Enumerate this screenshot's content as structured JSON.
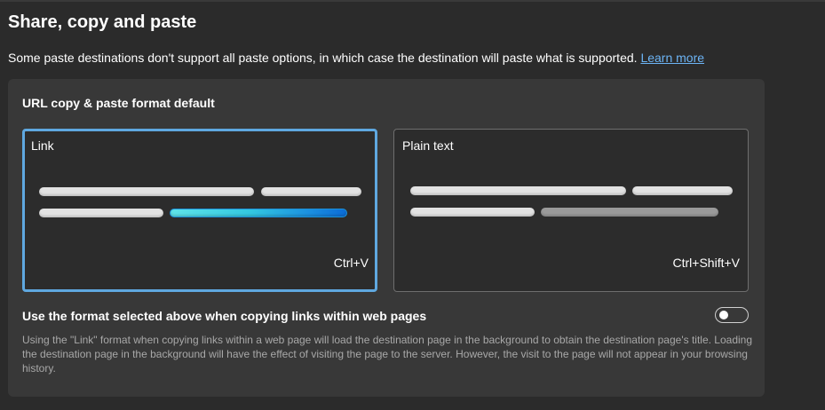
{
  "page": {
    "title": "Share, copy and paste",
    "description": "Some paste destinations don't support all paste options, in which case the destination will paste what is supported.",
    "learn_more": "Learn more"
  },
  "url_format": {
    "heading": "URL copy & paste format default",
    "options": [
      {
        "label": "Link",
        "shortcut": "Ctrl+V",
        "selected": true
      },
      {
        "label": "Plain text",
        "shortcut": "Ctrl+Shift+V",
        "selected": false
      }
    ]
  },
  "within_pages": {
    "label": "Use the format selected above when copying links within web pages",
    "enabled": false,
    "help": "Using the \"Link\" format when copying links within a web page will load the destination page in the background to obtain the destination page's title. Loading the destination page in the background will have the effect of visiting the page to the server. However, the visit to the page will not appear in your browsing history."
  },
  "colors": {
    "background": "#2b2b2b",
    "card": "#383838",
    "selected_border": "#5fa8e0",
    "link": "#6cb4f5",
    "accent_gradient_start": "#5fe3e8",
    "accent_gradient_end": "#0b6bd6"
  }
}
